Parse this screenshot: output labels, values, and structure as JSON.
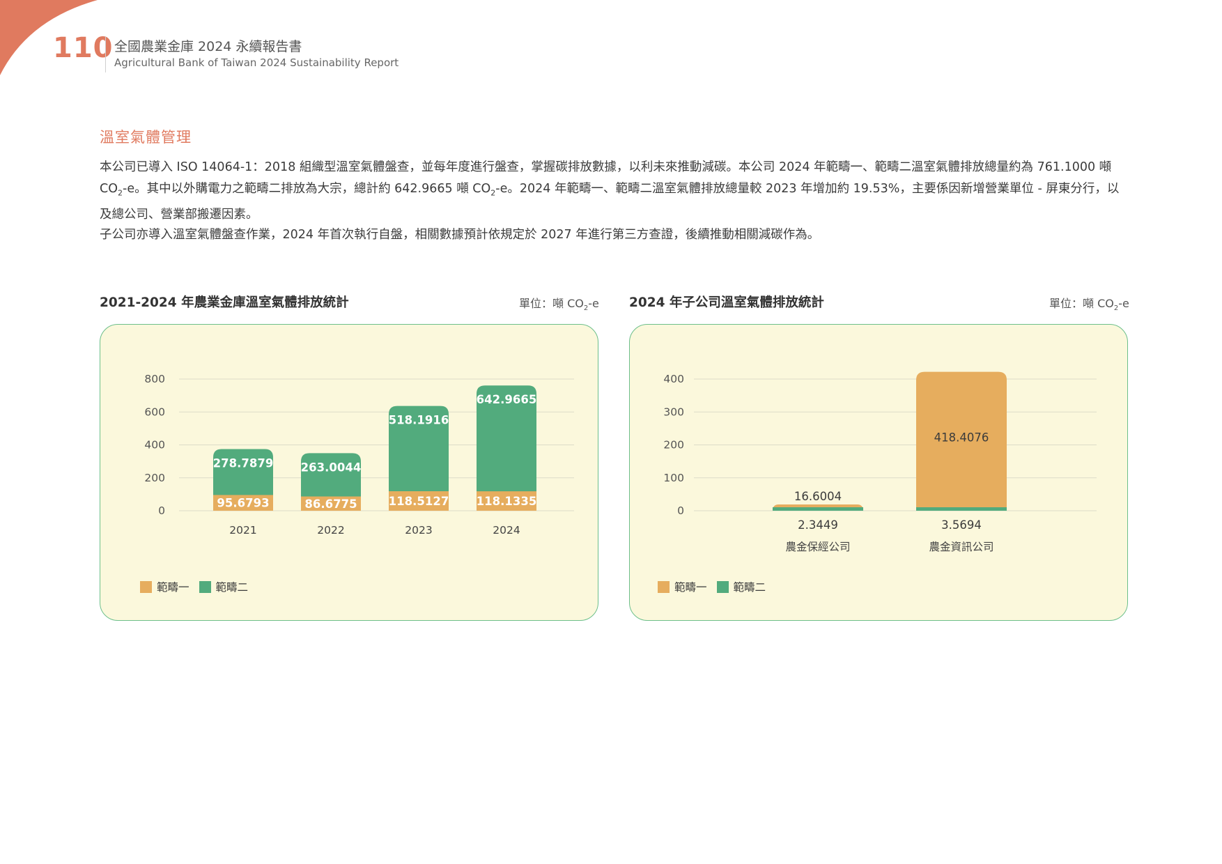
{
  "header": {
    "page_number": "110",
    "title_zh": "全國農業金庫 2024 永續報告書",
    "title_en": "Agricultural Bank of Taiwan 2024 Sustainability Report"
  },
  "colors": {
    "accent": "#e07a5f",
    "scope1": "#e6ad5e",
    "scope2": "#52ab7d",
    "panel_bg": "#fbf8dc",
    "panel_border": "#6cbf8a"
  },
  "section": {
    "title": "溫室氣體管理",
    "para1_part1": "本公司已導入 ISO 14064-1：2018 組織型溫室氣體盤查，並每年度進行盤查，掌握碳排放數據，以利未來推動減碳。本公司 2024 年範疇一、範疇二溫室氣體排放總量約為 761.1000 噸 CO",
    "para1_part2": "-e。其中以外購電力之範疇二排放為大宗，總計約 642.9665 噸 CO",
    "para1_part3": "-e。2024 年範疇一、範疇二溫室氣體排放總量較 2023 年增加約 19.53%，主要係因新增營業單位 - 屏東分行，以及總公司、營業部搬遷因素。",
    "para2": "子公司亦導入溫室氣體盤查作業，2024 年首次執行自盤，相關數據預計依規定於 2027 年進行第三方查證，後續推動相關減碳作為。",
    "subscript": "2"
  },
  "chart_data": [
    {
      "type": "bar",
      "stacked": true,
      "title": "2021-2024 年農業金庫溫室氣體排放統計",
      "unit_prefix": "單位：噸 CO",
      "unit_sub": "2",
      "unit_suffix": "-e",
      "categories": [
        "2021",
        "2022",
        "2023",
        "2024"
      ],
      "series": [
        {
          "name": "範疇一",
          "values": [
            95.6793,
            86.6775,
            118.5127,
            118.1335
          ],
          "labels": [
            "95.6793",
            "86.6775",
            "118.5127",
            "118.1335"
          ]
        },
        {
          "name": "範疇二",
          "values": [
            278.7879,
            263.0044,
            518.1916,
            642.9665
          ],
          "labels": [
            "278.7879",
            "263.0044",
            "518.1916",
            "642.9665"
          ]
        }
      ],
      "ylim": [
        0,
        800
      ],
      "yticks": [
        "0",
        "200",
        "400",
        "600",
        "800"
      ],
      "ytick_values": [
        0,
        200,
        400,
        600,
        800
      ],
      "grid": true,
      "legend": "bottom-left"
    },
    {
      "type": "bar",
      "stacked": true,
      "title": "2024 年子公司溫室氣體排放統計",
      "unit_prefix": "單位：噸 CO",
      "unit_sub": "2",
      "unit_suffix": "-e",
      "categories": [
        "農金保經公司",
        "農金資訊公司"
      ],
      "series": [
        {
          "name": "範疇一",
          "values": [
            16.6004,
            418.4076
          ],
          "labels": [
            "16.6004",
            "418.4076"
          ]
        },
        {
          "name": "範疇二",
          "values": [
            2.3449,
            3.5694
          ],
          "labels": [
            "2.3449",
            "3.5694"
          ]
        }
      ],
      "ylim": [
        0,
        400
      ],
      "yticks": [
        "0",
        "100",
        "200",
        "300",
        "400"
      ],
      "ytick_values": [
        0,
        100,
        200,
        300,
        400
      ],
      "grid": true,
      "legend": "bottom-left"
    }
  ]
}
